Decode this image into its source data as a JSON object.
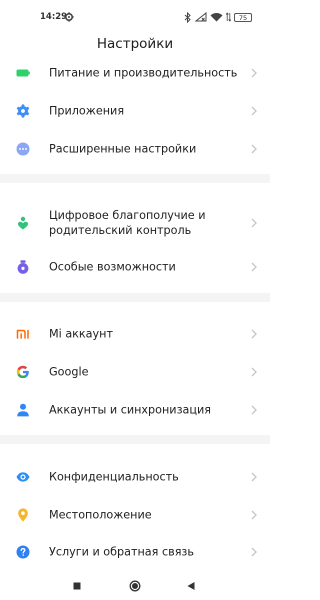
{
  "status_bar": {
    "time": "14:29",
    "battery": "75"
  },
  "header": {
    "title": "Настройки"
  },
  "settings": {
    "power": "Питание и производительность",
    "apps": "Приложения",
    "advanced": "Расширенные настройки",
    "wellbeing_line1": "Цифровое благополучие и",
    "wellbeing_line2": "родительский контроль",
    "accessibility": "Особые возможности",
    "mi_account": "Mi аккаунт",
    "google": "Google",
    "accounts_sync": "Аккаунты и синхронизация",
    "privacy": "Конфиденциальность",
    "location": "Местоположение",
    "services_feedback": "Услуги и обратная связь"
  },
  "icons": {
    "power": "battery-icon",
    "apps": "gear-icon",
    "advanced": "more-dots-icon",
    "wellbeing": "heart-person-icon",
    "accessibility": "accessibility-icon",
    "mi_account": "mi-logo-icon",
    "google": "google-icon",
    "accounts_sync": "person-icon",
    "privacy": "eye-icon",
    "location": "location-pin-icon",
    "services_feedback": "help-icon"
  },
  "colors": {
    "power": "#2ed16b",
    "apps": "#3e8ef7",
    "advanced": "#8aa6f5",
    "wellbeing": "#33c27a",
    "accessibility": "#7560e8",
    "mi_account": "#ff6900",
    "accounts_sync": "#2f86f6",
    "privacy": "#2c8df5",
    "location": "#f7b52b",
    "services_feedback": "#2f80f5"
  }
}
